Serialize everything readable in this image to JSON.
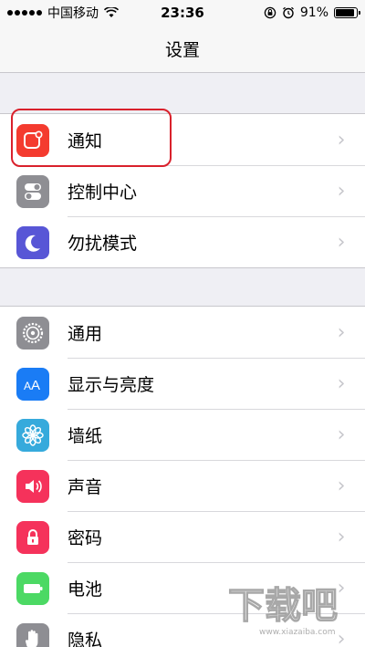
{
  "status_bar": {
    "carrier": "中国移动",
    "time": "23:36",
    "battery_percent": "91%",
    "battery_level": 0.91
  },
  "nav": {
    "title": "设置"
  },
  "groups": [
    {
      "items": [
        {
          "label": "通知",
          "icon": "notification-icon",
          "color": "#f43b2f"
        },
        {
          "label": "控制中心",
          "icon": "control-center-icon",
          "color": "#8e8e93"
        },
        {
          "label": "勿扰模式",
          "icon": "moon-icon",
          "color": "#5856d6"
        }
      ]
    },
    {
      "items": [
        {
          "label": "通用",
          "icon": "gear-icon",
          "color": "#8e8e93"
        },
        {
          "label": "显示与亮度",
          "icon": "display-brightness-icon",
          "color": "#1a7cf5"
        },
        {
          "label": "墙纸",
          "icon": "wallpaper-icon",
          "color": "#36aadc"
        },
        {
          "label": "声音",
          "icon": "speaker-icon",
          "color": "#f5325b"
        },
        {
          "label": "密码",
          "icon": "lock-icon",
          "color": "#f5325b"
        },
        {
          "label": "电池",
          "icon": "battery-icon",
          "color": "#4cd964"
        },
        {
          "label": "隐私",
          "icon": "hand-icon",
          "color": "#8e8e93"
        }
      ]
    }
  ],
  "watermark": {
    "text": "下载吧",
    "url_text": "www.xiazaiba.com"
  }
}
